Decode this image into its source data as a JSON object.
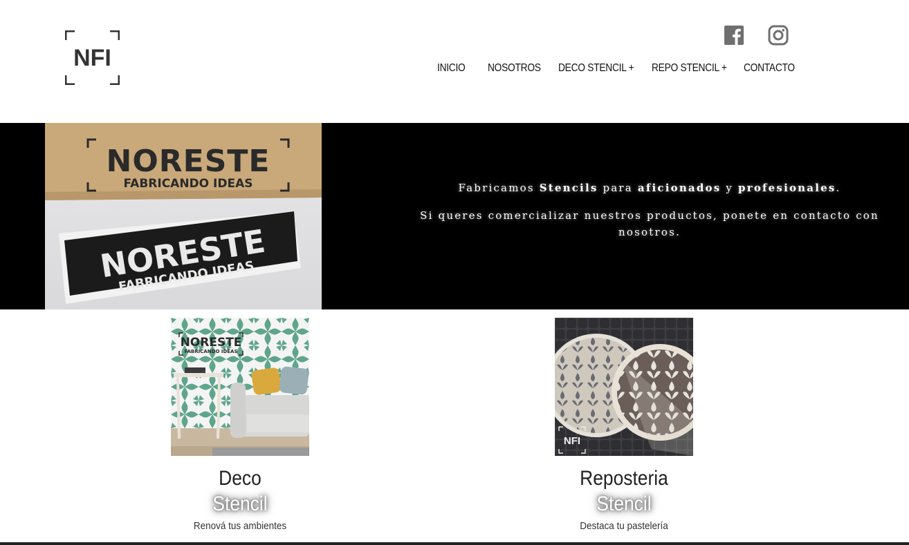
{
  "brand": {
    "logo_text": "NFI"
  },
  "social": [
    {
      "name": "facebook-icon",
      "color": "#6f6f6f"
    },
    {
      "name": "instagram-icon",
      "color": "#6f6f6f"
    }
  ],
  "nav": {
    "items": [
      {
        "label": "INICIO"
      },
      {
        "label": "NOSOTROS"
      },
      {
        "label": "DECO STENCIL +"
      },
      {
        "label": "REPO STENCIL +"
      },
      {
        "label": "CONTACTO"
      }
    ]
  },
  "hero": {
    "image": {
      "top_line1": "NORESTE",
      "top_line2": "FABRICANDO IDEAS",
      "bottom_line1": "NORESTE",
      "bottom_line2": "FABRICANDO IDEAS"
    },
    "p1_pre": "Fabricamos ",
    "p1_b1": "Stencils",
    "p1_mid1": " para ",
    "p1_b2": "aficionados",
    "p1_mid2": " y ",
    "p1_b3": "profesionales",
    "p1_end": ".",
    "p2": "Si queres comercializar nuestros productos, ponete en contacto con nosotros."
  },
  "cards": [
    {
      "title": "Deco",
      "subtitle": "Stencil",
      "description": "Renová tus ambientes",
      "image_line1": "NORESTE",
      "image_line2": "FABRICANDO IDEAS"
    },
    {
      "title": "Reposteria",
      "subtitle": "Stencil",
      "description": "Destaca tu pastelería",
      "image_badge": "NFI"
    }
  ],
  "colors": {
    "hero_bg": "#000000",
    "cardboard": "#c9a87a",
    "teal_pattern": "#5fa58c"
  }
}
